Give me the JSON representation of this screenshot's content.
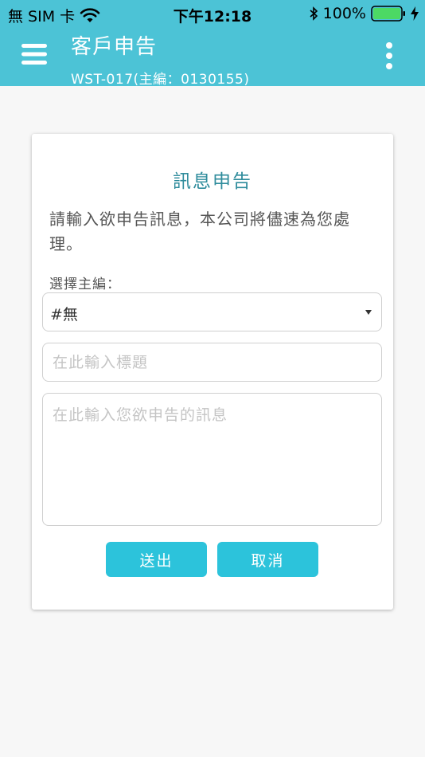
{
  "status_bar": {
    "carrier": "無 SIM 卡",
    "time": "下午12:18",
    "battery": "100%"
  },
  "header": {
    "title": "客戶申告",
    "subtitle": "WST-017(主編：0130155)",
    "icons": [
      "menu-icon",
      "more-vert-icon"
    ]
  },
  "form": {
    "title": "訊息申告",
    "description": "請輸入欲申告訊息，本公司將儘速為您處理。",
    "select_label": "選擇主編：",
    "select_value": "#無",
    "title_placeholder": "在此輸入標題",
    "title_value": "",
    "message_placeholder": "在此輸入您欲申告的訊息",
    "message_value": "",
    "submit_label": "送出",
    "cancel_label": "取消"
  },
  "colors": {
    "header_bg": "#4cc3d6",
    "button_bg": "#2cc3db",
    "card_title": "#2f8c9c",
    "battery_fill": "#4cd964"
  }
}
